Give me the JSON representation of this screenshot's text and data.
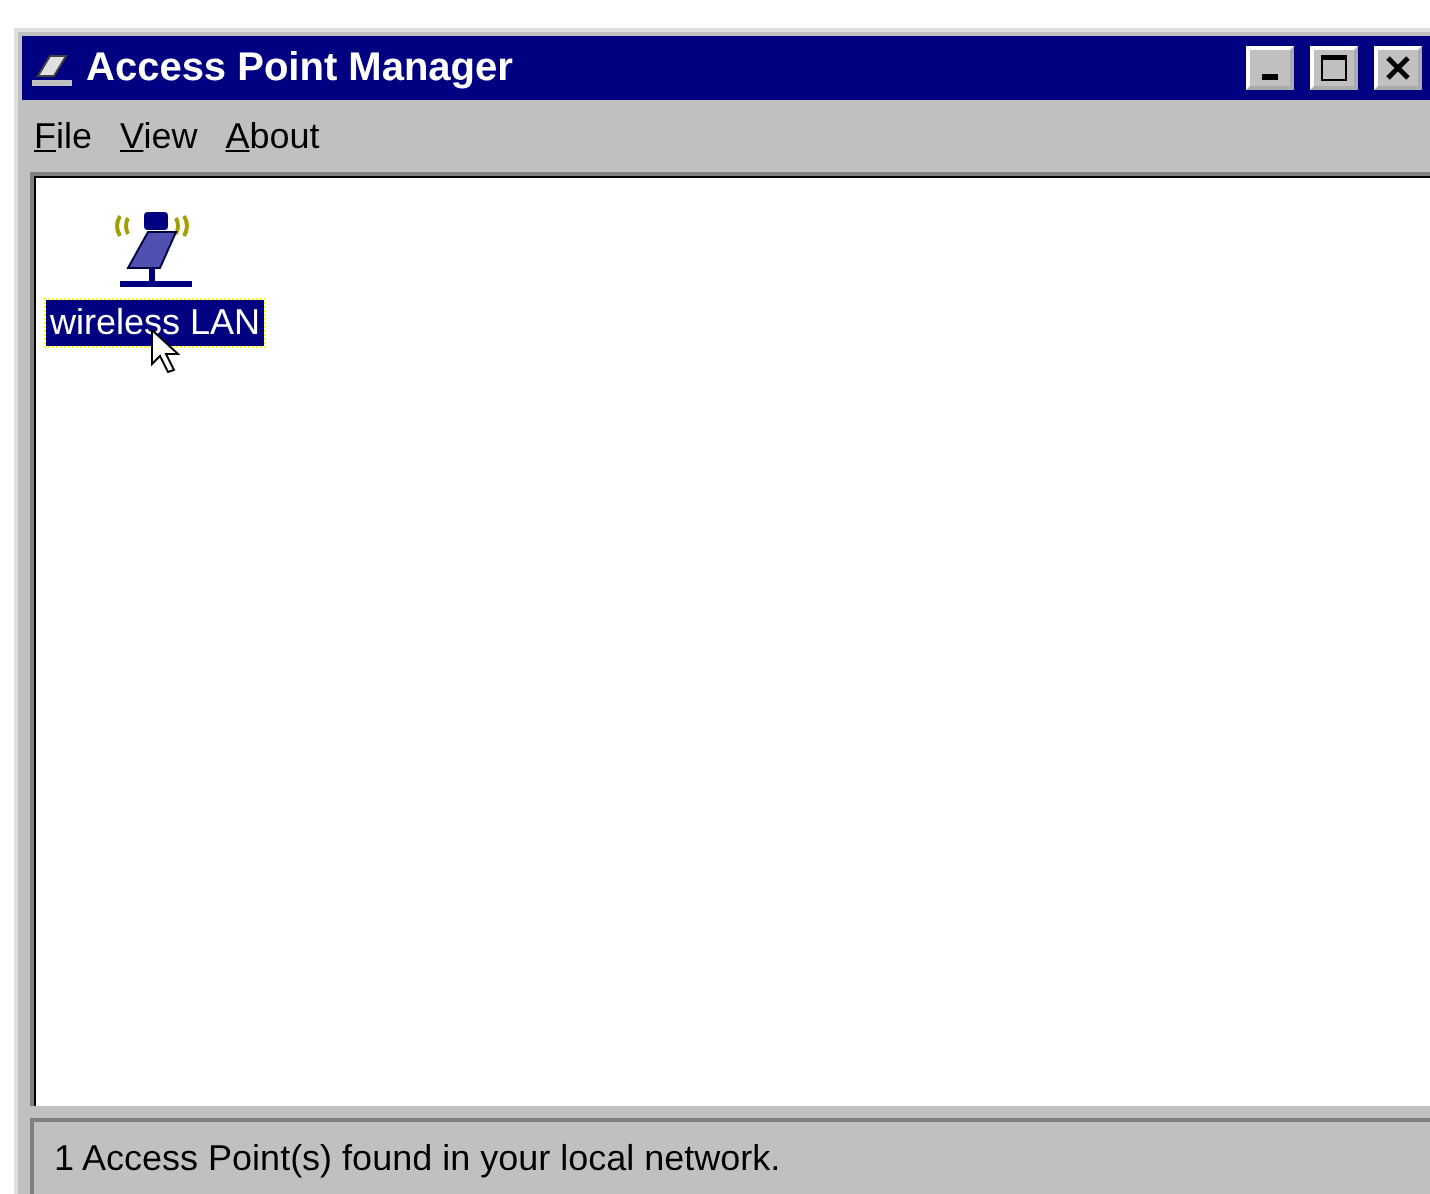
{
  "window": {
    "title": "Access Point Manager"
  },
  "menu": [
    "File",
    "View",
    "About"
  ],
  "items": [
    {
      "label": "wireless LAN",
      "selected": true
    }
  ],
  "status_bar": "1 Access Point(s) found in your local network."
}
